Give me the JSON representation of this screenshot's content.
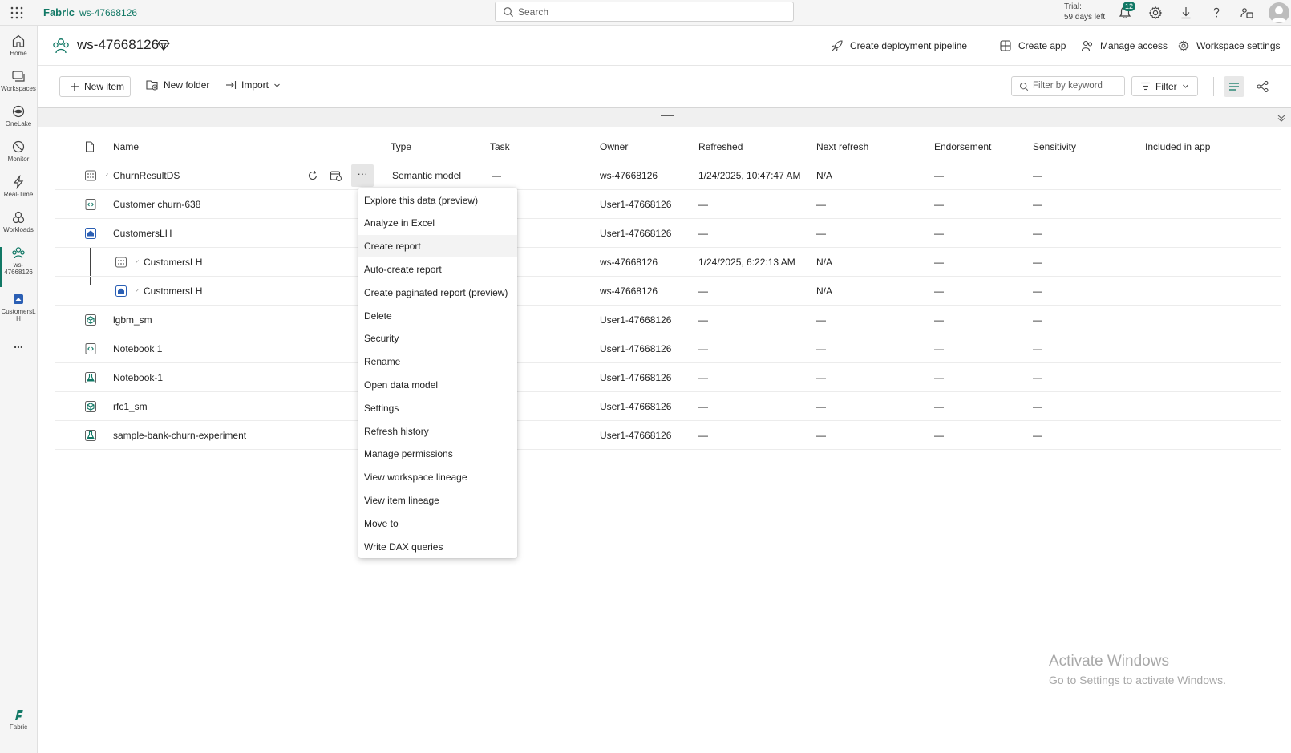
{
  "topbar": {
    "brand": "Fabric",
    "workspace": "ws-47668126",
    "search_placeholder": "Search",
    "trial_line1": "Trial:",
    "trial_line2": "59 days left",
    "notification_count": "12"
  },
  "rail": {
    "items": [
      {
        "label": "Home"
      },
      {
        "label": "Workspaces"
      },
      {
        "label": "OneLake"
      },
      {
        "label": "Monitor"
      },
      {
        "label": "Real-Time"
      },
      {
        "label": "Workloads"
      },
      {
        "label_line1": "ws-",
        "label_line2": "47668126"
      },
      {
        "label_line1": "CustomersL",
        "label_line2": "H"
      },
      {
        "label": "..."
      }
    ],
    "footer_label": "Fabric"
  },
  "header": {
    "title": "ws-47668126",
    "actions": [
      {
        "label": "Create deployment pipeline"
      },
      {
        "label": "Create app"
      },
      {
        "label": "Manage access"
      },
      {
        "label": "Workspace settings"
      }
    ]
  },
  "toolbar": {
    "new_item": "New item",
    "new_folder": "New folder",
    "import": "Import",
    "filter_placeholder": "Filter by keyword",
    "filter": "Filter"
  },
  "table": {
    "columns": {
      "name": "Name",
      "type": "Type",
      "task": "Task",
      "owner": "Owner",
      "refreshed": "Refreshed",
      "next_refresh": "Next refresh",
      "endorsement": "Endorsement",
      "sensitivity": "Sensitivity",
      "included": "Included in app"
    },
    "rows": [
      {
        "name": "ChurnResultDS",
        "type": "Semantic model",
        "task": "—",
        "owner": "ws-47668126",
        "refreshed": "1/24/2025, 10:47:47 AM",
        "next": "N/A",
        "endorsement": "—",
        "sensitivity": "—"
      },
      {
        "name": "Customer churn-638",
        "owner": "User1-47668126",
        "refreshed": "—",
        "next": "—",
        "endorsement": "—",
        "sensitivity": "—"
      },
      {
        "name": "CustomersLH",
        "owner": "User1-47668126",
        "refreshed": "—",
        "next": "—",
        "endorsement": "—",
        "sensitivity": "—"
      },
      {
        "name": "CustomersLH",
        "owner": "ws-47668126",
        "refreshed": "1/24/2025, 6:22:13 AM",
        "next": "N/A",
        "endorsement": "—",
        "sensitivity": "—"
      },
      {
        "name": "CustomersLH",
        "owner": "ws-47668126",
        "refreshed": "—",
        "next": "N/A",
        "endorsement": "—",
        "sensitivity": "—"
      },
      {
        "name": "lgbm_sm",
        "owner": "User1-47668126",
        "refreshed": "—",
        "next": "—",
        "endorsement": "—",
        "sensitivity": "—"
      },
      {
        "name": "Notebook 1",
        "owner": "User1-47668126",
        "refreshed": "—",
        "next": "—",
        "endorsement": "—",
        "sensitivity": "—"
      },
      {
        "name": "Notebook-1",
        "owner": "User1-47668126",
        "refreshed": "—",
        "next": "—",
        "endorsement": "—",
        "sensitivity": "—"
      },
      {
        "name": "rfc1_sm",
        "owner": "User1-47668126",
        "refreshed": "—",
        "next": "—",
        "endorsement": "—",
        "sensitivity": "—"
      },
      {
        "name": "sample-bank-churn-experiment",
        "owner": "User1-47668126",
        "refreshed": "—",
        "next": "—",
        "endorsement": "—",
        "sensitivity": "—"
      }
    ],
    "more_label": "···"
  },
  "context_menu": {
    "items": [
      "Explore this data (preview)",
      "Analyze in Excel",
      "Create report",
      "Auto-create report",
      "Create paginated report (preview)",
      "Delete",
      "Security",
      "Rename",
      "Open data model",
      "Settings",
      "Refresh history",
      "Manage permissions",
      "View workspace lineage",
      "View item lineage",
      "Move to",
      "Write DAX queries"
    ],
    "hovered": "Create report"
  },
  "watermark": {
    "line1": "Activate Windows",
    "line2": "Go to Settings to activate Windows."
  },
  "colors": {
    "accent": "#117865"
  }
}
